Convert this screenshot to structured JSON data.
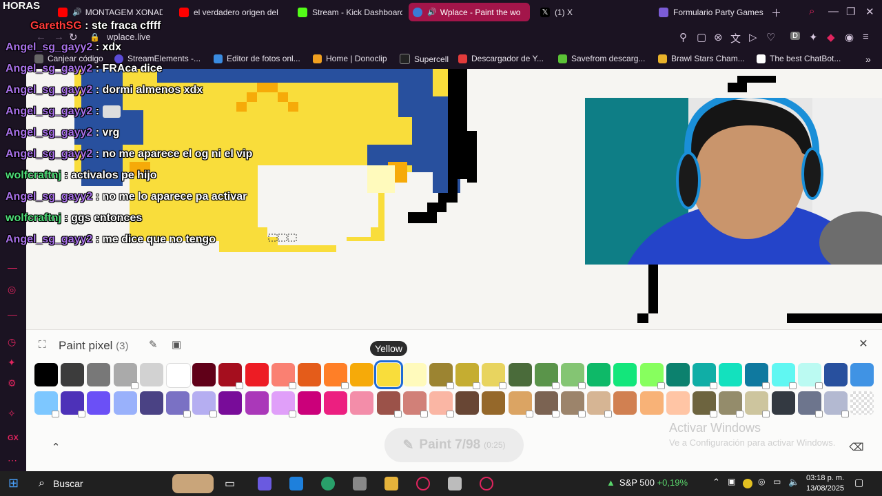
{
  "overlay_title": "HORAS",
  "tabs": [
    {
      "label": "MONTAGEM XONADA",
      "color": "#ff0000"
    },
    {
      "label": "el verdadero origen del",
      "color": "#ff0000"
    },
    {
      "label": "Stream - Kick Dashboard",
      "color": "#53fc18"
    },
    {
      "label": "Wplace - Paint the wo",
      "color": "#3a7bd5",
      "active": true
    },
    {
      "label": "(1) X",
      "color": "#000000"
    },
    {
      "label": "Formulario Party Games",
      "color": "#7b5cd6"
    }
  ],
  "address": {
    "url": "wplace.live"
  },
  "bookmarks": [
    {
      "label": "Canjear código"
    },
    {
      "label": "StreamElements -..."
    },
    {
      "label": "Editor de fotos onl..."
    },
    {
      "label": "Home | Donoclip"
    },
    {
      "label": "Supercell"
    },
    {
      "label": "Descargador de Y..."
    },
    {
      "label": "Savefrom descarg..."
    },
    {
      "label": "Brawl Stars Cham..."
    },
    {
      "label": "The best ChatBot..."
    }
  ],
  "chat": [
    {
      "user": "GarethSG",
      "msg": "ste fraca cffff",
      "cls": "red"
    },
    {
      "user": "Angel_sg_gayy2",
      "msg": "xdx",
      "cls": ""
    },
    {
      "user": "Angel_sg_gayy2",
      "msg": "FRAca dice",
      "cls": ""
    },
    {
      "user": "Angel_sg_gayy2",
      "msg": "dormi almenos xdx",
      "cls": ""
    },
    {
      "user": "Angel_sg_gayy2",
      "msg": "",
      "cls": ""
    },
    {
      "user": "Angel_sg_gayy2",
      "msg": "vrg",
      "cls": ""
    },
    {
      "user": "Angel_sg_gayy2",
      "msg": "no me aparece el og ni el vip",
      "cls": ""
    },
    {
      "user": "wolfcraftnj",
      "msg": "activalos pe hijo",
      "cls": "green"
    },
    {
      "user": "Angel_sg_gayy2",
      "msg": "no me lo aparece pa activar",
      "cls": ""
    },
    {
      "user": "wolfcraftnj",
      "msg": "ggs entonces",
      "cls": "green"
    },
    {
      "user": "Angel_sg_gayy2",
      "msg": "me dice que no tengo",
      "cls": ""
    }
  ],
  "panel": {
    "title": "Paint pixel",
    "count": "(3)",
    "tooltip": "Yellow",
    "paint_label": "Paint",
    "paint_count": "7/98",
    "paint_timer": "(0:25)",
    "activate_title": "Activar Windows",
    "activate_sub": "Ve a Configuración para activar Windows."
  },
  "palette_row1": [
    {
      "c": "#000000",
      "l": false
    },
    {
      "c": "#3c3c3c",
      "l": false
    },
    {
      "c": "#787878",
      "l": false
    },
    {
      "c": "#aaaaaa",
      "l": true
    },
    {
      "c": "#d2d2d2",
      "l": false
    },
    {
      "c": "#ffffff",
      "l": false
    },
    {
      "c": "#600018",
      "l": false
    },
    {
      "c": "#a50e1e",
      "l": true
    },
    {
      "c": "#ed1c24",
      "l": false
    },
    {
      "c": "#fa8072",
      "l": true
    },
    {
      "c": "#e45c1a",
      "l": false
    },
    {
      "c": "#ff7f27",
      "l": true
    },
    {
      "c": "#f6aa09",
      "l": false
    },
    {
      "c": "#f9dd3b",
      "l": false,
      "sel": true
    },
    {
      "c": "#fffabc",
      "l": false
    },
    {
      "c": "#9c8431",
      "l": true
    },
    {
      "c": "#c5ad31",
      "l": true
    },
    {
      "c": "#e8d45f",
      "l": true
    },
    {
      "c": "#4a6b3a",
      "l": false
    },
    {
      "c": "#5a944a",
      "l": true
    },
    {
      "c": "#84c573",
      "l": true
    },
    {
      "c": "#0eb968",
      "l": false
    },
    {
      "c": "#13e67b",
      "l": false
    },
    {
      "c": "#87ff5e",
      "l": true
    },
    {
      "c": "#0c816e",
      "l": false
    },
    {
      "c": "#10aea6",
      "l": true
    },
    {
      "c": "#13e1be",
      "l": false
    },
    {
      "c": "#0f799f",
      "l": true
    },
    {
      "c": "#60f7f2",
      "l": true
    },
    {
      "c": "#bbfaf2",
      "l": true
    },
    {
      "c": "#28509e",
      "l": false
    },
    {
      "c": "#4093e4",
      "l": false
    }
  ],
  "palette_row2": [
    {
      "c": "#7dc7ff",
      "l": true
    },
    {
      "c": "#4d31b8",
      "l": true
    },
    {
      "c": "#6b50f6",
      "l": false
    },
    {
      "c": "#99b1fb",
      "l": false
    },
    {
      "c": "#4a4284",
      "l": false
    },
    {
      "c": "#7a71c4",
      "l": true
    },
    {
      "c": "#b5aef1",
      "l": true
    },
    {
      "c": "#780c99",
      "l": false
    },
    {
      "c": "#aa38b9",
      "l": false
    },
    {
      "c": "#e09ff9",
      "l": true
    },
    {
      "c": "#cb007a",
      "l": false
    },
    {
      "c": "#ec1f80",
      "l": false
    },
    {
      "c": "#f38da9",
      "l": false
    },
    {
      "c": "#9b5249",
      "l": true
    },
    {
      "c": "#d18078",
      "l": true
    },
    {
      "c": "#fab6a4",
      "l": true
    },
    {
      "c": "#684634",
      "l": false
    },
    {
      "c": "#95682a",
      "l": false
    },
    {
      "c": "#dba463",
      "l": true
    },
    {
      "c": "#7b6352",
      "l": true
    },
    {
      "c": "#9c846b",
      "l": true
    },
    {
      "c": "#d6b594",
      "l": true
    },
    {
      "c": "#d18051",
      "l": false
    },
    {
      "c": "#f8b277",
      "l": false
    },
    {
      "c": "#ffc5a5",
      "l": false
    },
    {
      "c": "#6d643f",
      "l": true
    },
    {
      "c": "#948c6b",
      "l": true
    },
    {
      "c": "#cdc59e",
      "l": true
    },
    {
      "c": "#333941",
      "l": false
    },
    {
      "c": "#6d758d",
      "l": true
    },
    {
      "c": "#b3b9d1",
      "l": true
    },
    {
      "c": "transparent",
      "l": false
    }
  ],
  "taskbar": {
    "search": "Buscar",
    "ticker": "S&P 500",
    "ticker_change": "+0,19%",
    "time": "03:18 p. m.",
    "date": "13/08/2025"
  }
}
